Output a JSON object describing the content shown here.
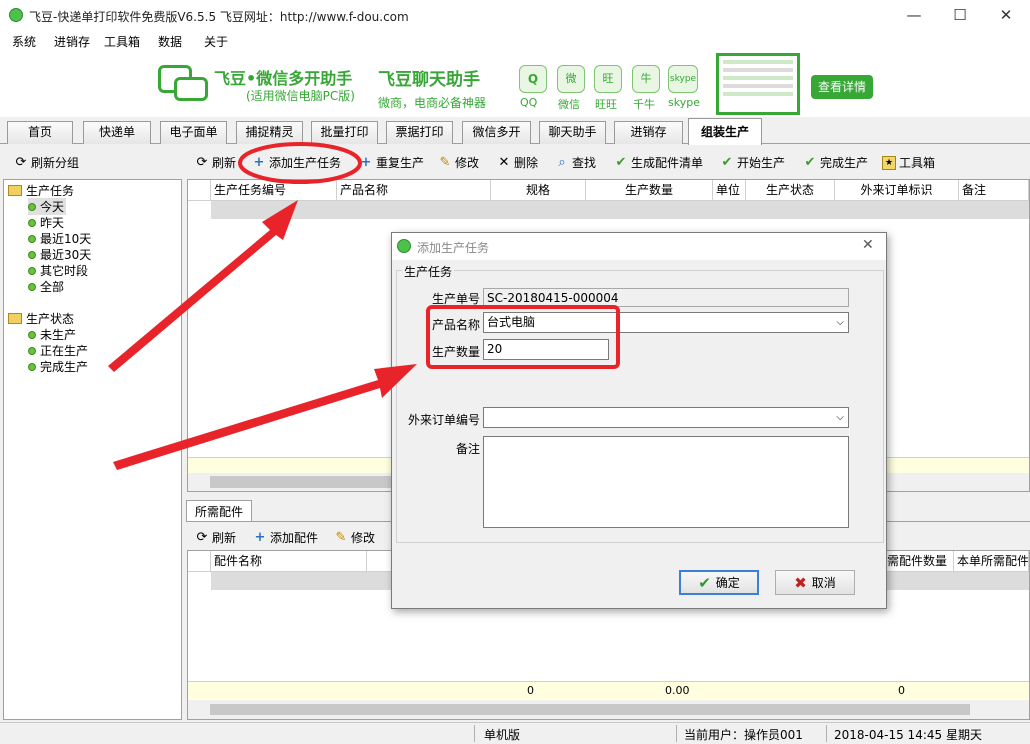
{
  "window": {
    "title": "飞豆-快递单打印软件免费版V6.5.5  飞豆网址：http://www.f-dou.com",
    "minimize": "—",
    "maximize": "☐",
    "close": "✕"
  },
  "menu": [
    "系统",
    "进销存",
    "工具箱",
    "数据",
    "关于"
  ],
  "banner": {
    "brand": "飞豆•微信多开助手",
    "brand_sub": "(适用微信电脑PC版)",
    "chat_title": "飞豆聊天助手",
    "chat_sub": "微商，电商必备神器",
    "apps": [
      "QQ",
      "微信",
      "旺旺",
      "千牛",
      "skype"
    ],
    "app_icon_text": [
      "Q",
      "微",
      "旺",
      "牛",
      "skype"
    ],
    "detail_button": "查看详情",
    "green": "#37a736"
  },
  "tabs": [
    "首页",
    "快递单",
    "电子面单",
    "捕捉精灵",
    "批量打印",
    "票据打印",
    "微信多开",
    "聊天助手",
    "进销存",
    "组装生产"
  ],
  "left_toolbar": {
    "refresh_group": "刷新分组"
  },
  "toolbar": {
    "refresh": "刷新",
    "add_task": "添加生产任务",
    "repeat": "重复生产",
    "edit": "修改",
    "delete": "删除",
    "find": "查找",
    "gen_parts": "生成配件清单",
    "start": "开始生产",
    "finish": "完成生产",
    "toolbox": "工具箱"
  },
  "tree": {
    "group1": "生产任务",
    "group1_items": [
      "今天",
      "昨天",
      "最近10天",
      "最近30天",
      "其它时段",
      "全部"
    ],
    "group2": "生产状态",
    "group2_items": [
      "未生产",
      "正在生产",
      "完成生产"
    ]
  },
  "main_grid": {
    "columns": [
      "生产任务编号",
      "产品名称",
      "规格",
      "生产数量",
      "单位",
      "生产状态",
      "外来订单标识",
      "备注"
    ]
  },
  "parts_panel": {
    "tab": "所需配件",
    "refresh": "刷新",
    "add": "添加配件",
    "edit": "修改",
    "columns": [
      "配件名称",
      "需配件数量",
      "本单所需配件"
    ],
    "footer": [
      "0",
      "0.00",
      "0"
    ]
  },
  "dialog": {
    "title": "添加生产任务",
    "group": "生产任务",
    "order_no_label": "生产单号",
    "order_no": "SC-20180415-000004",
    "product_label": "产品名称",
    "product": "台式电脑",
    "qty_label": "生产数量",
    "qty": "20",
    "ext_order_label": "外来订单编号",
    "ext_order": "",
    "remark_label": "备注",
    "remark": "",
    "ok": "确定",
    "cancel": "取消"
  },
  "status": {
    "mode": "单机版",
    "user_label": "当前用户：",
    "user": "操作员001",
    "datetime": "2018-04-15 14:45 星期天"
  },
  "annotation_color": "#e8242a"
}
